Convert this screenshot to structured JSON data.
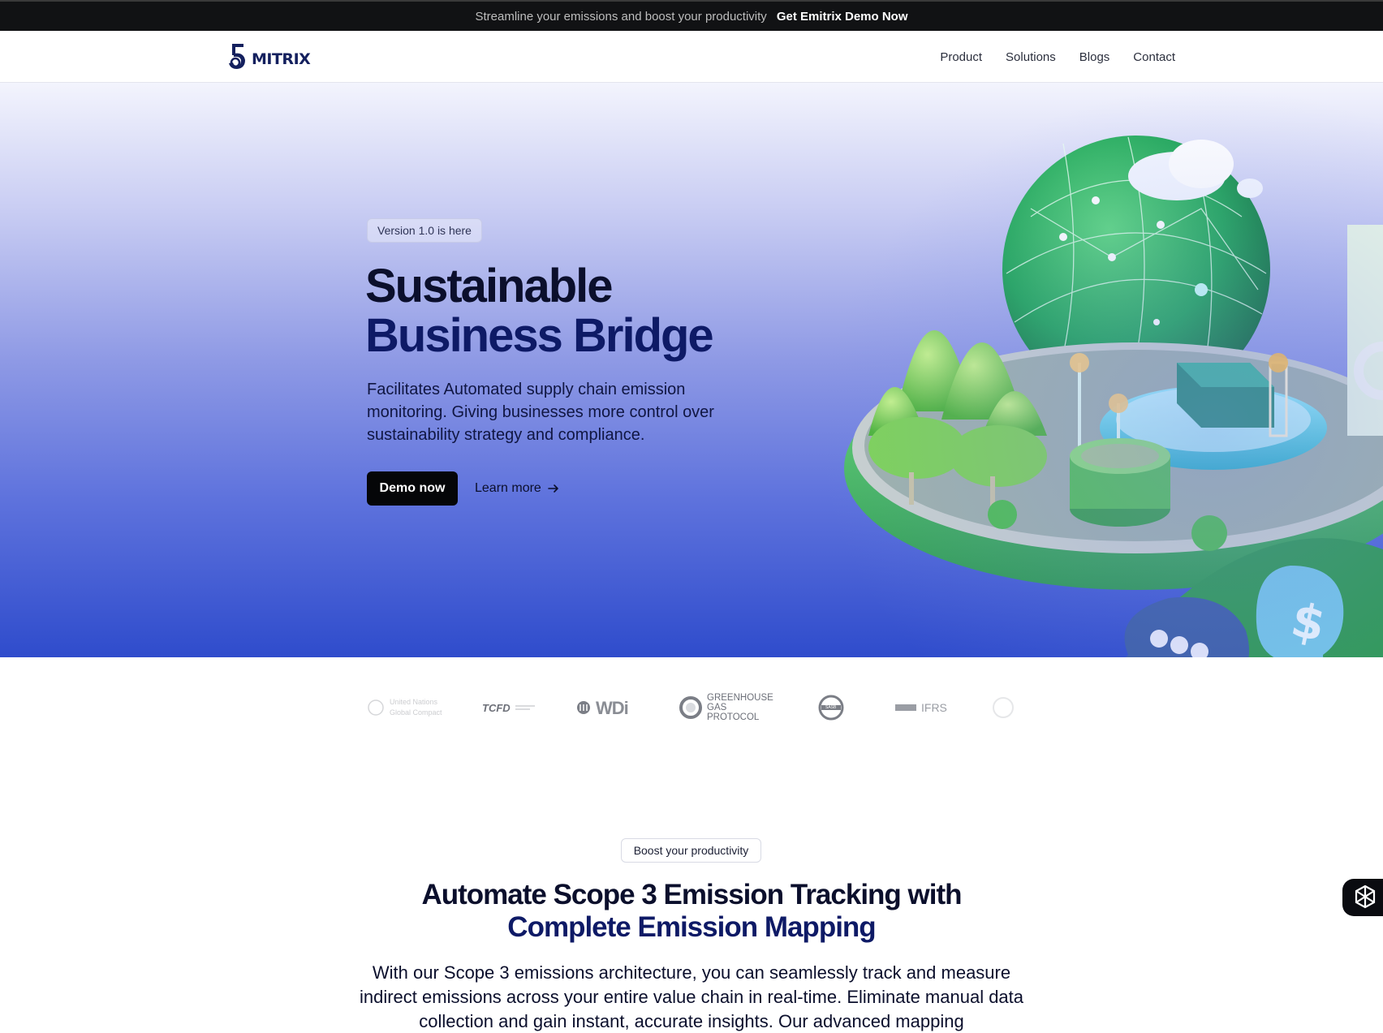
{
  "announcement": {
    "message": "Streamline your emissions and boost your productivity",
    "cta": "Get Emitrix Demo Now"
  },
  "nav": {
    "logo_text": "MITRIX",
    "links": [
      "Product",
      "Solutions",
      "Blogs",
      "Contact"
    ]
  },
  "hero": {
    "badge": "Version 1.0 is here",
    "title_line1": "Sustainable",
    "title_line2": "Business Bridge",
    "description": "Facilitates Automated supply chain emission monitoring. Giving businesses more control over sustainability strategy and compliance.",
    "primary_button": "Demo now",
    "secondary_button": "Learn more",
    "secondary_icon": "arrow-right-icon"
  },
  "partners": [
    {
      "name": "United Nations Global Compact",
      "text": "United Nations Global Compact"
    },
    {
      "name": "TCFD",
      "text": "TCFD"
    },
    {
      "name": "WDi",
      "text": "WDi"
    },
    {
      "name": "Greenhouse Gas Protocol",
      "text": "GREENHOUSE GAS PROTOCOL"
    },
    {
      "name": "SASB",
      "text": "SASB"
    },
    {
      "name": "IFRS",
      "text": "IFRS"
    }
  ],
  "section": {
    "pill": "Boost your productivity",
    "title_line1": "Automate Scope 3 Emission Tracking with",
    "title_line2": "Complete Emission Mapping",
    "description": "With our Scope 3 emissions architecture, you can seamlessly track and measure indirect emissions across your entire value chain in real-time. Eliminate manual data collection and gain instant, accurate insights. Our advanced mapping"
  },
  "chat_widget": {
    "icon": "openai-knot-icon"
  },
  "colors": {
    "accent_dark": "#0e1a66",
    "button": "#050608",
    "topbar": "#111214"
  }
}
